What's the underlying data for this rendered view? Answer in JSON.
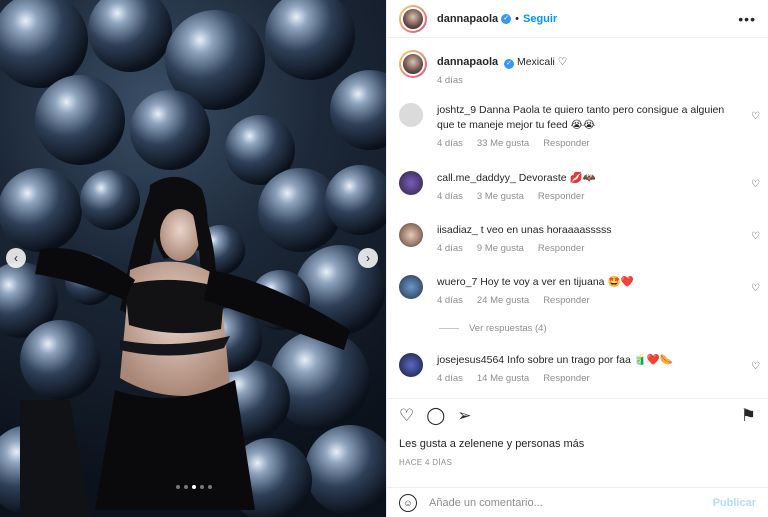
{
  "post": {
    "username": "dannapaola",
    "follow_label": "Seguir",
    "more_label": "•••"
  },
  "caption": {
    "username": "dannapaola",
    "text": "Mexicali ♡",
    "time": "4 días"
  },
  "comments": [
    {
      "username": "joshtz_9",
      "text": "Danna Paola te quiero tanto pero consigue a alguien que te maneje mejor tu feed 😭😭",
      "time": "4 días",
      "likes": "33 Me gusta",
      "reply": "Responder"
    },
    {
      "username": "call.me_daddyy_",
      "text": "Devoraste 💋🦇",
      "time": "4 días",
      "likes": "3 Me gusta",
      "reply": "Responder"
    },
    {
      "username": "iisadiaz_",
      "text": "t veo en unas horaaaasssss",
      "time": "4 días",
      "likes": "9 Me gusta",
      "reply": "Responder"
    },
    {
      "username": "wuero_7",
      "text": "Hoy te voy a ver en tijuana 🤩❤️",
      "time": "4 días",
      "likes": "24 Me gusta",
      "reply": "Responder"
    },
    {
      "username": "josejesus4564",
      "text": "Info sobre un trago por faa 🧃❤️🌭",
      "time": "4 días",
      "likes": "14 Me gusta",
      "reply": "Responder"
    }
  ],
  "view_replies": "Ver respuestas (4)",
  "likes_text": "Les gusta a zelenene y personas más",
  "time_ago": "HACE 4 DÍAS",
  "composer": {
    "placeholder": "Añade un comentario...",
    "publish_label": "Publicar"
  },
  "icons": {
    "like": "heart-icon",
    "comment": "comment-icon",
    "share": "send-icon",
    "save": "bookmark-icon",
    "emoji": "smile-icon"
  },
  "colors": {
    "accent": "#0095f6",
    "publish_disabled": "#b3dbff",
    "muted": "#8e8e8e"
  }
}
